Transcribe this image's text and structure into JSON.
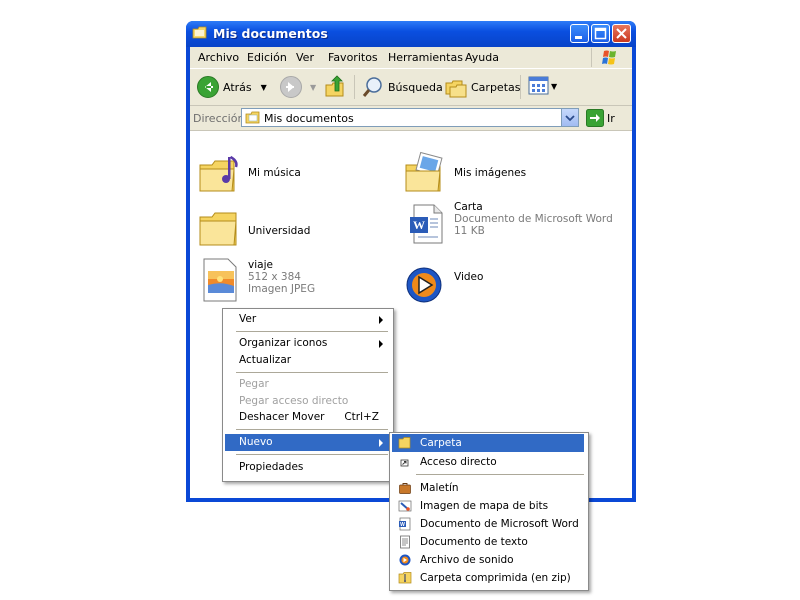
{
  "window": {
    "title": "Mis documentos",
    "colors": {
      "titlebar": "#0a4fe0",
      "menubar": "#ece9d8",
      "selection": "#316ac5"
    }
  },
  "menubar": {
    "items": [
      "Archivo",
      "Edición",
      "Ver",
      "Favoritos",
      "Herramientas",
      "Ayuda"
    ]
  },
  "toolbar": {
    "back_label": "Atrás",
    "search_label": "Búsqueda",
    "folders_label": "Carpetas"
  },
  "addressbar": {
    "label": "Dirección",
    "value": "Mis documentos",
    "go_label": "Ir"
  },
  "files": [
    {
      "name": "Mi música",
      "icon": "music-folder-icon"
    },
    {
      "name": "Mis imágenes",
      "icon": "pictures-folder-icon"
    },
    {
      "name": "Universidad",
      "icon": "folder-icon"
    },
    {
      "name": "Carta",
      "line2": "Documento de Microsoft Word",
      "line3": "11 KB",
      "icon": "word-document-icon"
    },
    {
      "name": "viaje",
      "line2": "512 x 384",
      "line3": "Imagen JPEG",
      "icon": "jpeg-image-icon"
    },
    {
      "name": "Video",
      "icon": "media-player-icon"
    }
  ],
  "context_menu": {
    "ver": "Ver",
    "organizar": "Organizar iconos",
    "actualizar": "Actualizar",
    "pegar": "Pegar",
    "pegar_acceso": "Pegar acceso directo",
    "deshacer": "Deshacer Mover",
    "deshacer_shortcut": "Ctrl+Z",
    "nuevo": "Nuevo",
    "propiedades": "Propiedades"
  },
  "submenu": {
    "carpeta": "Carpeta",
    "acceso_directo": "Acceso directo",
    "maletin": "Maletín",
    "bitmap": "Imagen de mapa de bits",
    "word": "Documento de Microsoft Word",
    "texto": "Documento de texto",
    "sonido": "Archivo de sonido",
    "zip": "Carpeta comprimida (en zip)"
  }
}
